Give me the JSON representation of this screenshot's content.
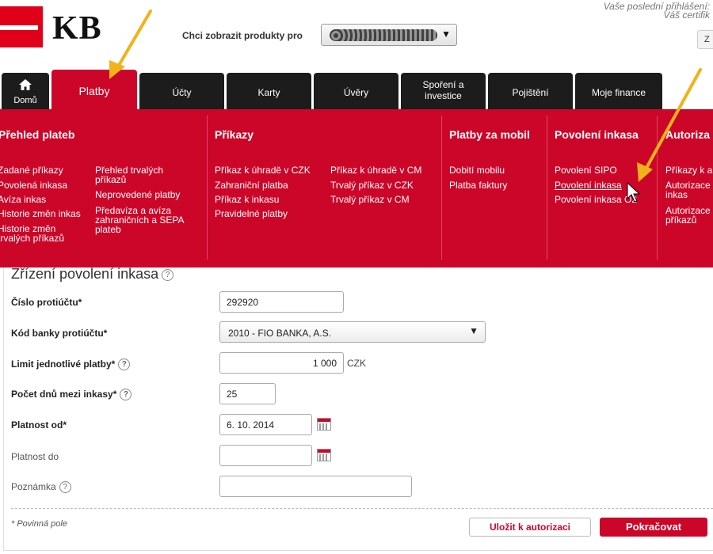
{
  "header": {
    "logo_text": "KB",
    "products_label": "Chci zobrazit produkty pro",
    "products_selected": "",
    "last_login": "Vaše poslední přihlášení:",
    "certificate": "Váš certifik",
    "lang_button": "Z"
  },
  "tabs": [
    {
      "label": "Domů"
    },
    {
      "label": "Platby"
    },
    {
      "label": "Účty"
    },
    {
      "label": "Karty"
    },
    {
      "label": "Úvěry"
    },
    {
      "label": "Spoření a investice"
    },
    {
      "label": "Pojištění"
    },
    {
      "label": "Moje finance"
    }
  ],
  "menu": {
    "prehled": {
      "title": "Přehled plateb",
      "links": [
        "Zadané příkazy",
        "Povolená inkasa",
        "Avíza inkas",
        "Historie změn inkas",
        "Historie změn trvalých příkazů",
        "Přehled trvalých příkazů",
        "Neprovedené platby",
        "Předavíza a avíza zahraničních a SEPA plateb"
      ]
    },
    "prikazy": {
      "title": "Příkazy",
      "links": [
        "Příkaz k úhradě v CZK",
        "Zahraniční platba",
        "Příkaz k inkasu",
        "Pravidelné platby",
        "Příkaz k úhradě v CM",
        "Trvalý příkaz v CZK",
        "Trvalý příkaz v CM"
      ]
    },
    "mobil": {
      "title": "Platby za mobil",
      "links": [
        "Dobití mobilu",
        "Platba faktury"
      ]
    },
    "inkasa": {
      "title": "Povolení inkasa",
      "links": [
        "Povolení SIPO",
        "Povolení inkasa",
        "Povolení inkasa O2"
      ]
    },
    "autorizace": {
      "title": "Autoriza",
      "links": [
        "Příkazy k a",
        "Autorizace inkas",
        "Autorizace příkazů"
      ]
    }
  },
  "form": {
    "title": "Zřízení povolení inkasa",
    "help_glyph": "?",
    "fields": {
      "cislo": {
        "label": "Číslo protiúčtu*",
        "value": "292920"
      },
      "kod": {
        "label": "Kód banky protiúčtu*",
        "value": "2010 - FIO BANKA, A.S."
      },
      "limit": {
        "label": "Limit jednotlivé platby*",
        "value": "1 000",
        "unit": "CZK"
      },
      "pocet": {
        "label": "Počet dnů mezi inkasy*",
        "value": "25"
      },
      "od": {
        "label": "Platnost od*",
        "value": "6. 10. 2014"
      },
      "do": {
        "label": "Platnost do",
        "value": ""
      },
      "poznamka": {
        "label": "Poznámka",
        "value": ""
      }
    },
    "required_note": "* Povinná pole",
    "save_label": "Uložit k autorizaci",
    "continue_label": "Pokračovat"
  },
  "colors": {
    "brand_red": "#cc0629",
    "tab_dark": "#1c1c1c",
    "annotation_arrow": "#f2b21b"
  }
}
